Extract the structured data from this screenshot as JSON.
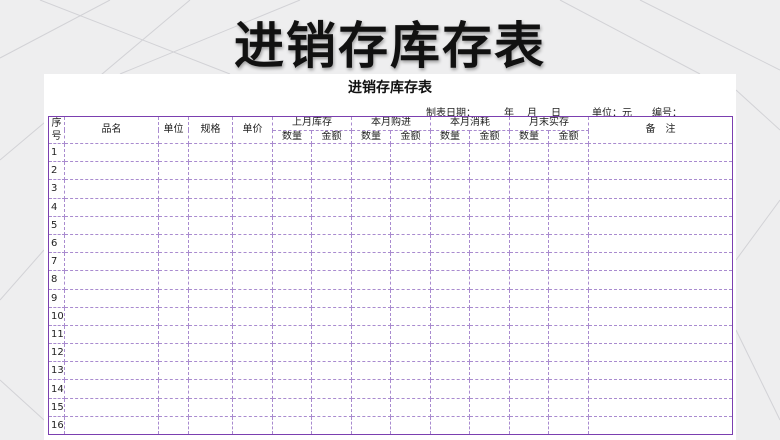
{
  "banner": {
    "title": "进销存库存表"
  },
  "sheet": {
    "title": "进销存库存表",
    "meta": {
      "date_label": "制表日期：",
      "year": "年",
      "month": "月",
      "day": "日",
      "unit_label": "单位：元",
      "number_label": "编号："
    }
  },
  "table": {
    "headers": {
      "seq_top": "序",
      "seq_bottom": "号",
      "name": "品名",
      "unit": "单位",
      "spec": "规格",
      "price": "单价",
      "last_stock": "上月库存",
      "purchase": "本月购进",
      "consume": "本月消耗",
      "end_stock": "月末实存",
      "qty": "数量",
      "amount": "金额",
      "remark": "备　注"
    },
    "rows": [
      "1",
      "2",
      "3",
      "4",
      "5",
      "6",
      "7",
      "8",
      "9",
      "10",
      "11",
      "12",
      "13",
      "14",
      "15",
      "16"
    ]
  },
  "colors": {
    "border": "#7b3fb0",
    "background": "#eeeeef"
  }
}
